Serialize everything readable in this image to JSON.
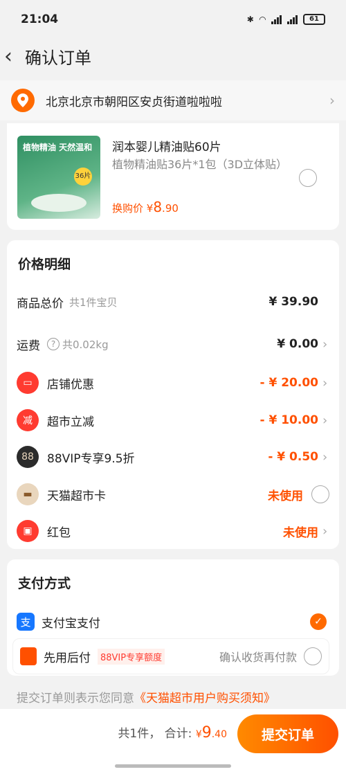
{
  "status": {
    "time": "21:04",
    "battery": "61"
  },
  "nav": {
    "title": "确认订单"
  },
  "address": {
    "text": "北京北京市朝阳区安贞街道啦啦啦"
  },
  "product": {
    "image_text": "植物精油 天然温和",
    "image_badge": "36片",
    "title": "润本婴儿精油贴60片",
    "spec": "植物精油贴36片*1包（3D立体贴）",
    "price_label": "换购价 ¥",
    "price_int": "8",
    "price_dec": ".90"
  },
  "price_detail": {
    "title": "价格明细",
    "rows": [
      {
        "label": "商品总价",
        "sub": "共1件宝贝",
        "value": "¥ 39.90"
      },
      {
        "label": "运费",
        "sub": "共0.02kg",
        "value": "¥ 0.00"
      },
      {
        "label": "店铺优惠",
        "value": "- ¥ 20.00"
      },
      {
        "label": "超市立减",
        "value": "- ¥ 10.00"
      },
      {
        "label": "88VIP专享9.5折",
        "value": "- ¥ 0.50"
      },
      {
        "label": "天猫超市卡",
        "value": "未使用"
      },
      {
        "label": "红包",
        "value": "未使用"
      }
    ],
    "icons": {
      "coupon": "coupon-icon",
      "reduce": "减",
      "vip": "88",
      "card": "card-icon",
      "redpacket": "red-packet-icon"
    },
    "colors": {
      "accent": "#ff5000",
      "coupon": "#ff3b30",
      "vip": "#2b2b2b",
      "card": "#e9d6bd"
    }
  },
  "payment": {
    "title": "支付方式",
    "alipay_icon": "支",
    "alipay_label": "支付宝支付",
    "later_label": "先用后付",
    "later_tag": "88VIP专享额度",
    "later_right": "确认收货再付款"
  },
  "agreement": {
    "prefix": "提交订单则表示您同意",
    "link": "《天猫超市用户购买须知》"
  },
  "footer": {
    "count": "共1件，",
    "total_label": "合计:",
    "currency": "¥",
    "total_int": "9",
    "total_dec": ".40",
    "submit_label": "提交订单"
  }
}
